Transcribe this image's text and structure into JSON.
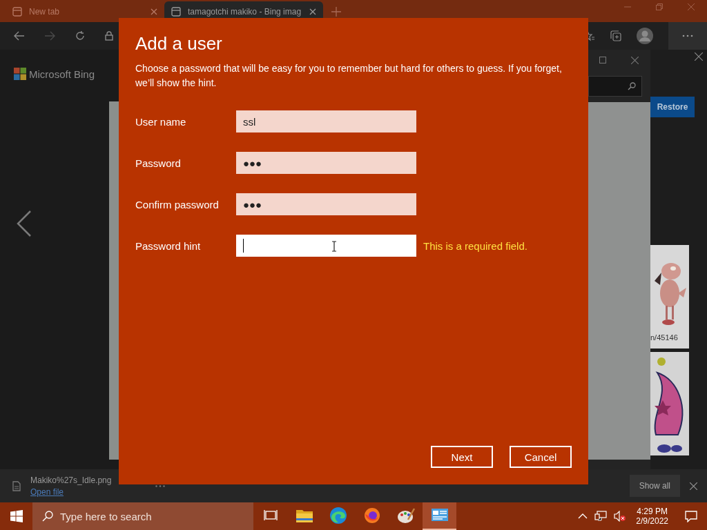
{
  "browser": {
    "tabs": [
      {
        "title": "New tab",
        "selected": false
      },
      {
        "title": "tamagotchi makiko - Bing imag",
        "selected": true
      }
    ],
    "logo": "Microsoft Bing",
    "side_panel": {
      "button": "Restore",
      "caption": "n/45146"
    },
    "download": {
      "file": "Makiko%27s_Idle.png",
      "link": "Open file",
      "show_all": "Show all"
    }
  },
  "dialog": {
    "title": "Add a user",
    "description": "Choose a password that will be easy for you to remember but hard for others to guess. If you forget, we’ll show the hint.",
    "fields": [
      {
        "label": "User name",
        "value": "ssl",
        "focused": false
      },
      {
        "label": "Password",
        "value": "●●●",
        "focused": false
      },
      {
        "label": "Confirm password",
        "value": "●●●",
        "focused": false
      },
      {
        "label": "Password hint",
        "focused": true,
        "error": "This is a required field."
      }
    ],
    "buttons": [
      "Next",
      "Cancel"
    ]
  },
  "taskbar": {
    "search_placeholder": "Type here to search",
    "apps": [
      {
        "kind": "task-view",
        "selected": false
      },
      {
        "kind": "folder",
        "selected": false
      },
      {
        "kind": "edge",
        "selected": false
      },
      {
        "kind": "firefox",
        "selected": false
      },
      {
        "kind": "paint",
        "selected": false
      },
      {
        "kind": "control-panel",
        "selected": true
      }
    ],
    "time": "4:29 PM",
    "date": "2/9/2022"
  }
}
